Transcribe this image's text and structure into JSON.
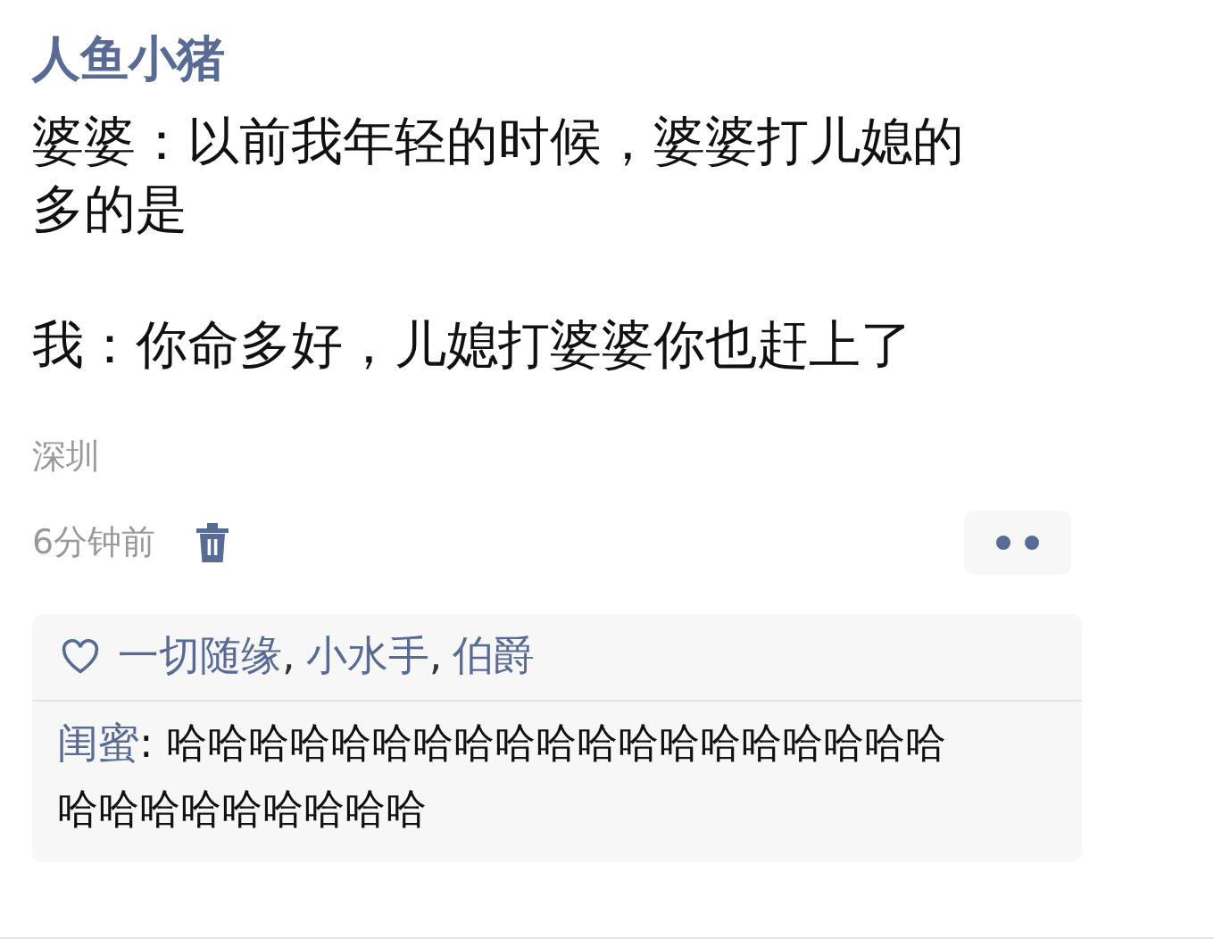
{
  "post": {
    "author": "人鱼小猪",
    "paragraphs": [
      "婆婆：以前我年轻的时候，婆婆打儿媳的多的是",
      "我：你命多好，儿媳打婆婆你也赶上了"
    ],
    "location": "深圳",
    "time": "6分钟前"
  },
  "likes": [
    "一切随缘",
    "小水手",
    "伯爵"
  ],
  "likes_separator": ",",
  "comments": [
    {
      "author": "闺蜜",
      "separator": ":",
      "text": "哈哈哈哈哈哈哈哈哈哈哈哈哈哈哈哈哈哈哈哈哈哈哈哈哈哈哈哈"
    }
  ]
}
